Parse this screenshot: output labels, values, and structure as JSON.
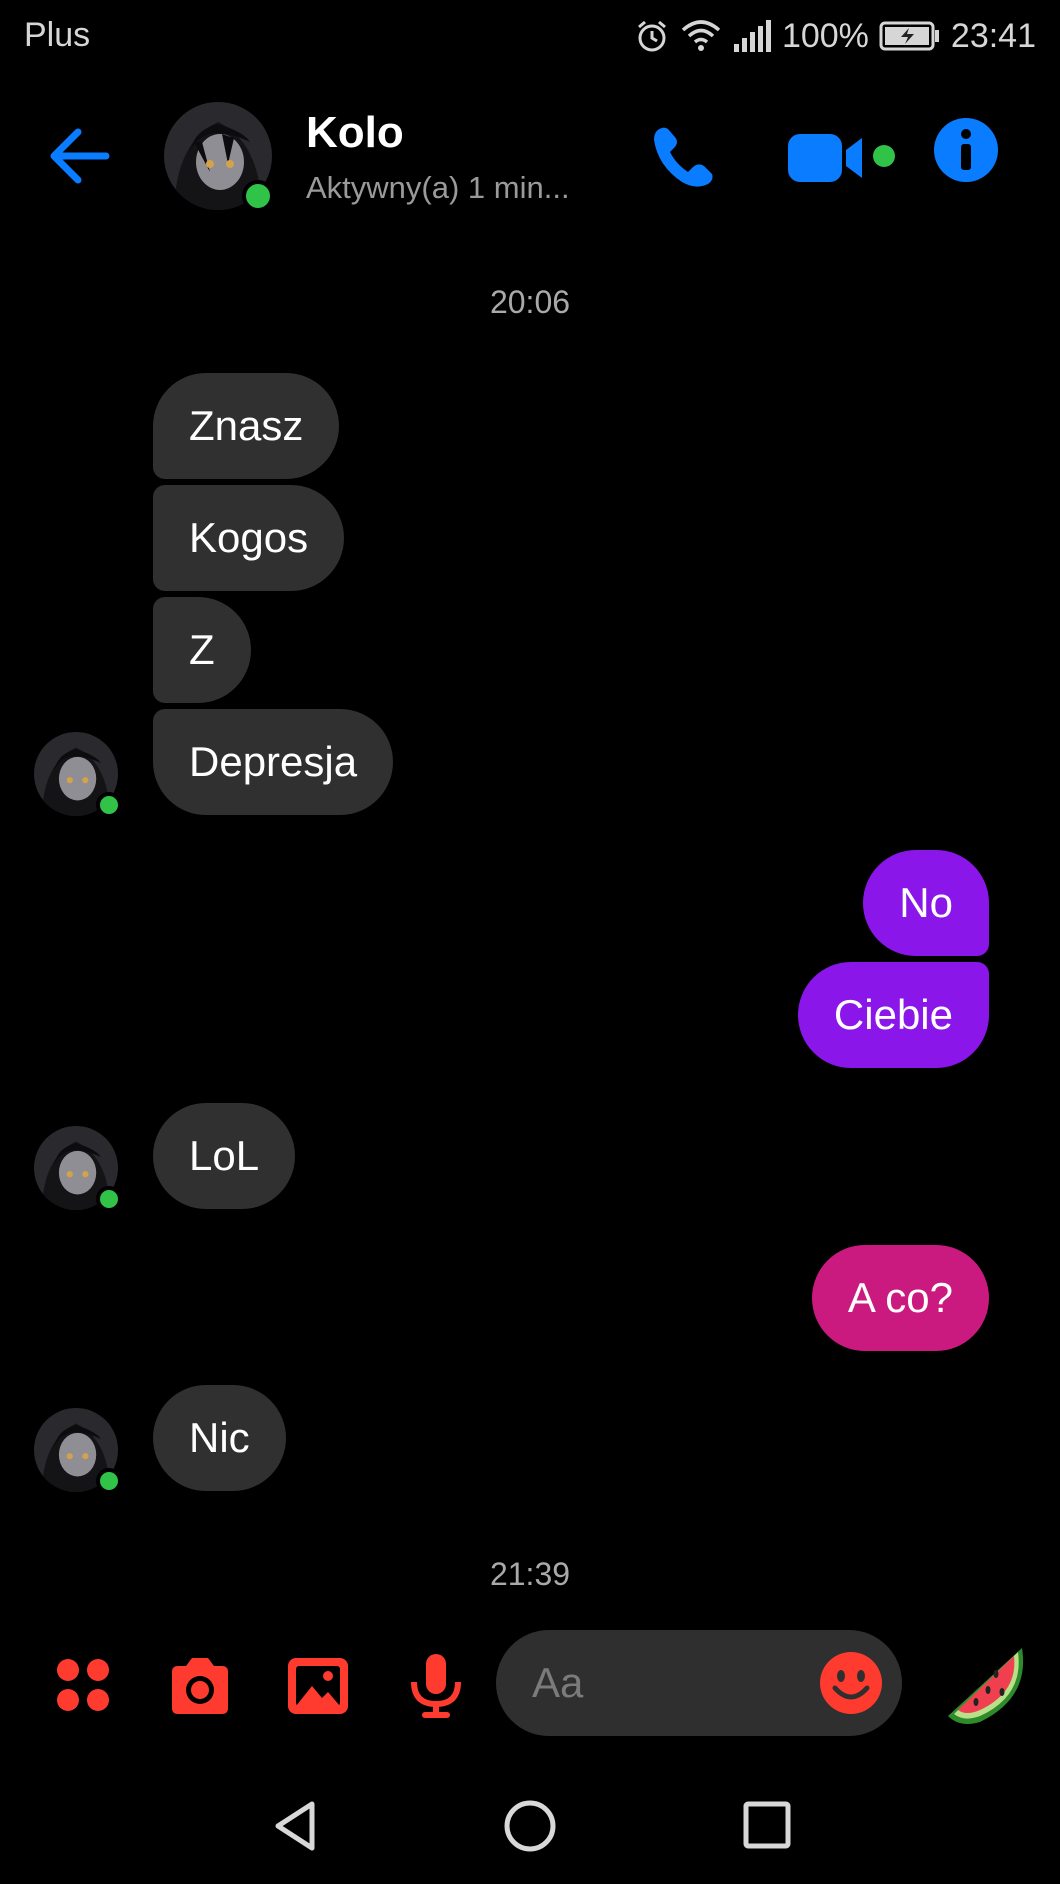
{
  "status_bar": {
    "carrier": "Plus",
    "battery": "100%",
    "time": "23:41"
  },
  "header": {
    "back_icon": "arrow-left-icon",
    "contact_name": "Kolo",
    "contact_status": "Aktywny(a) 1 min...",
    "call_icon": "phone-icon",
    "video_icon": "video-camera-icon",
    "info_icon": "info-icon"
  },
  "colors": {
    "accent_blue": "#0a7cff",
    "composer_red": "#ff3b30",
    "outgoing_purple": "#8b16ea",
    "outgoing_magenta": "#cb1a7f",
    "incoming_gray": "#303030",
    "online_green": "#31c248"
  },
  "messages": [
    {
      "kind": "timestamp",
      "text": "20:06"
    },
    {
      "kind": "incoming",
      "text": "Znasz"
    },
    {
      "kind": "incoming",
      "text": "Kogos"
    },
    {
      "kind": "incoming",
      "text": "Z"
    },
    {
      "kind": "incoming",
      "text": "Depresja"
    },
    {
      "kind": "outgoing",
      "text": "No"
    },
    {
      "kind": "outgoing",
      "text": "Ciebie"
    },
    {
      "kind": "incoming",
      "text": "LoL"
    },
    {
      "kind": "outgoing",
      "text": "A co?"
    },
    {
      "kind": "incoming",
      "text": "Nic"
    },
    {
      "kind": "timestamp",
      "text": "21:39"
    }
  ],
  "composer": {
    "placeholder": "Aa",
    "icons": [
      "menu-dots-icon",
      "camera-icon",
      "image-icon",
      "microphone-icon",
      "emoji-icon",
      "watermelon-sticker-icon"
    ]
  },
  "nav_bar": {
    "icons": [
      "nav-back-icon",
      "nav-home-icon",
      "nav-recents-icon"
    ]
  }
}
